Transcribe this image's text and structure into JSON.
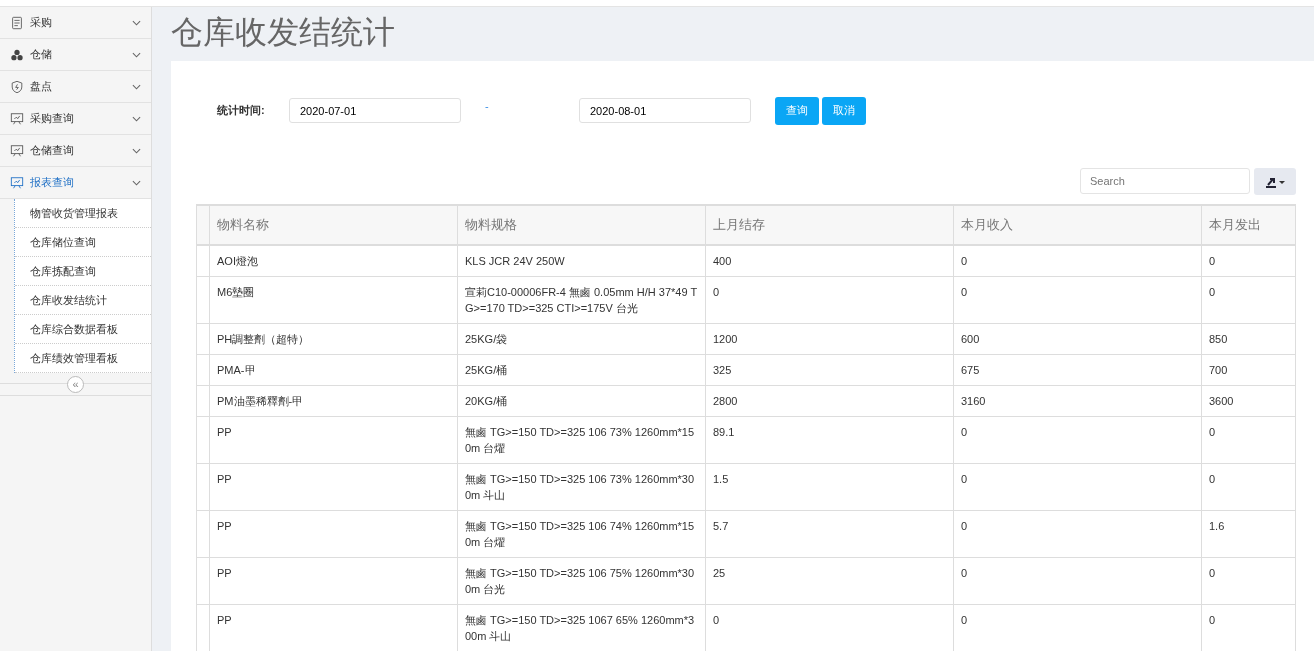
{
  "sidebar": {
    "items": [
      {
        "label": "采购",
        "expanded": false
      },
      {
        "label": "仓储",
        "expanded": false
      },
      {
        "label": "盘点",
        "expanded": false
      },
      {
        "label": "采购查询",
        "expanded": false
      },
      {
        "label": "仓储查询",
        "expanded": false
      },
      {
        "label": "报表查询",
        "expanded": true,
        "children": [
          {
            "label": "物管收货管理报表"
          },
          {
            "label": "仓库储位查询"
          },
          {
            "label": "仓库拣配查询"
          },
          {
            "label": "仓库收发结统计"
          },
          {
            "label": "仓库综合数据看板"
          },
          {
            "label": "仓库绩效管理看板"
          }
        ]
      }
    ],
    "collapse": "«"
  },
  "page_title": "仓库收发结统计",
  "filter": {
    "label": "统计时间:",
    "start": "2020-07-01",
    "separator": "-",
    "end": "2020-08-01",
    "buttons": [
      "查询",
      "取消"
    ]
  },
  "search": {
    "placeholder": "Search"
  },
  "table": {
    "columns": [
      "物料名称",
      "物料规格",
      "上月结存",
      "本月收入",
      "本月发出"
    ],
    "rows": [
      [
        "AOI燈泡",
        "KLS JCR 24V 250W",
        "400",
        "0",
        "0"
      ],
      [
        "M6墊圈",
        "宣莉C10-00006FR-4 無鹵 0.05mm H/H 37*49 TG>=170 TD>=325 CTI>=175V 台光",
        "0",
        "0",
        "0"
      ],
      [
        "PH調整劑（超特）",
        "25KG/袋",
        "1200",
        "600",
        "850"
      ],
      [
        "PMA-甲",
        "25KG/桶",
        "325",
        "675",
        "700"
      ],
      [
        "PM油墨稀釋劑-甲",
        "20KG/桶",
        "2800",
        "3160",
        "3600"
      ],
      [
        "PP",
        "無鹵 TG>=150 TD>=325 106 73% 1260mm*150m 台燿",
        "89.1",
        "0",
        "0"
      ],
      [
        "PP",
        "無鹵 TG>=150 TD>=325 106 73% 1260mm*300m 斗山",
        "1.5",
        "0",
        "0"
      ],
      [
        "PP",
        "無鹵 TG>=150 TD>=325 106 74% 1260mm*150m 台燿",
        "5.7",
        "0",
        "1.6"
      ],
      [
        "PP",
        "無鹵 TG>=150 TD>=325 106 75% 1260mm*300m 台光",
        "25",
        "0",
        "0"
      ],
      [
        "PP",
        "無鹵 TG>=150 TD>=325 1067 65% 1260mm*300m 斗山",
        "0",
        "0",
        "0"
      ]
    ]
  }
}
